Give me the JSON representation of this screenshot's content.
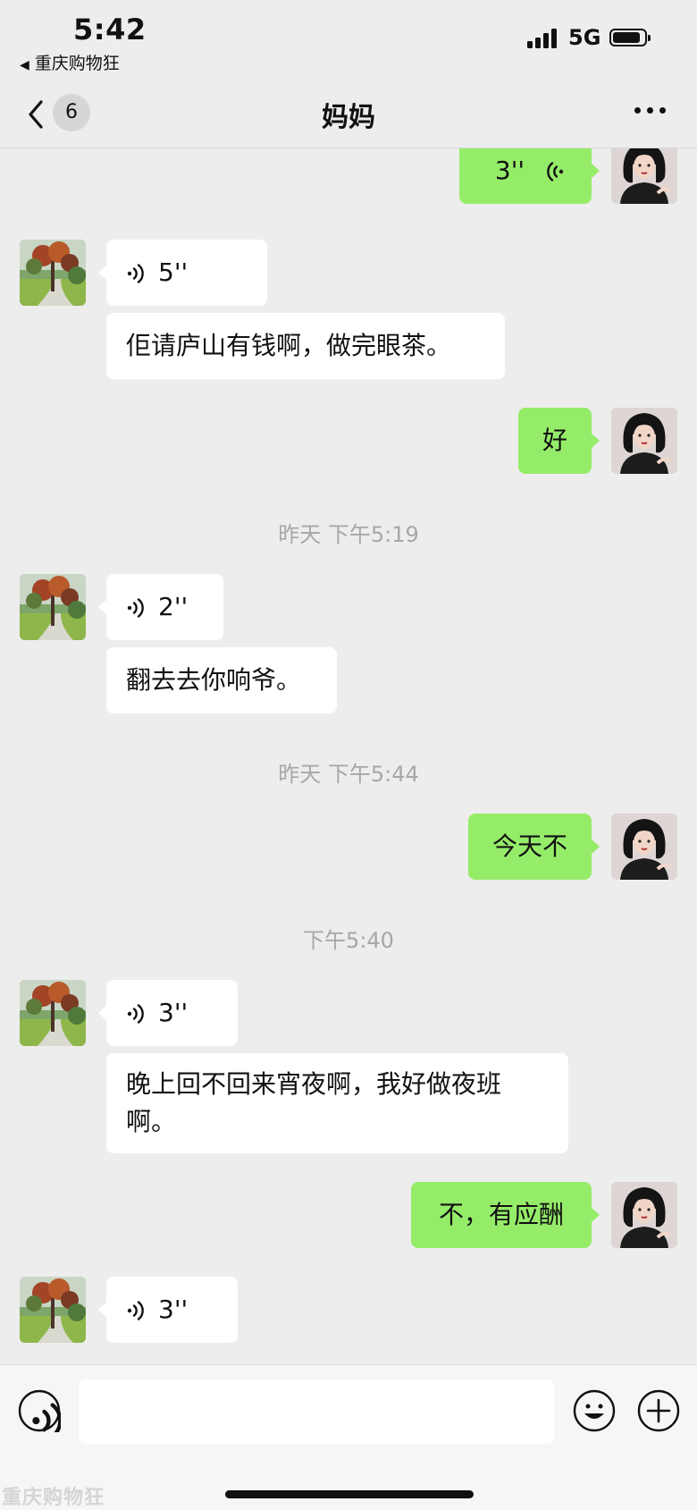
{
  "status_bar": {
    "time": "5:42",
    "back_app": "重庆购物狂",
    "network": "5G"
  },
  "nav": {
    "unread_count": "6",
    "title": "妈妈"
  },
  "messages": [
    {
      "side": "out",
      "type": "voice",
      "duration": "3''"
    },
    {
      "side": "in",
      "type": "voice",
      "duration": "5''"
    },
    {
      "side": "in",
      "type": "text",
      "text": "佢请庐山有钱啊，做完眼茶。"
    },
    {
      "side": "out",
      "type": "text",
      "text": "好"
    },
    {
      "type": "timestamp",
      "text": "昨天 下午5:19"
    },
    {
      "side": "in",
      "type": "voice",
      "duration": "2''"
    },
    {
      "side": "in",
      "type": "text",
      "text": "翻去去你响爷。"
    },
    {
      "type": "timestamp",
      "text": "昨天 下午5:44"
    },
    {
      "side": "out",
      "type": "text",
      "text": "今天不"
    },
    {
      "type": "timestamp",
      "text": "下午5:40"
    },
    {
      "side": "in",
      "type": "voice",
      "duration": "3''"
    },
    {
      "side": "in",
      "type": "text",
      "text_line1": "晚上回不回来宵夜啊，我好做夜班",
      "text_line2": "啊。"
    },
    {
      "side": "out",
      "type": "text",
      "text": "不，有应酬"
    },
    {
      "side": "in",
      "type": "voice",
      "duration": "3''"
    }
  ],
  "input_bar": {
    "watermark": "重庆购物狂"
  },
  "colors": {
    "outgoing_bubble": "#95ec69",
    "incoming_bubble": "#ffffff",
    "background": "#ededed"
  },
  "icons": [
    "back-chevron-icon",
    "more-icon",
    "voice-wave-icon",
    "voice-input-icon",
    "emoji-icon",
    "plus-icon"
  ]
}
